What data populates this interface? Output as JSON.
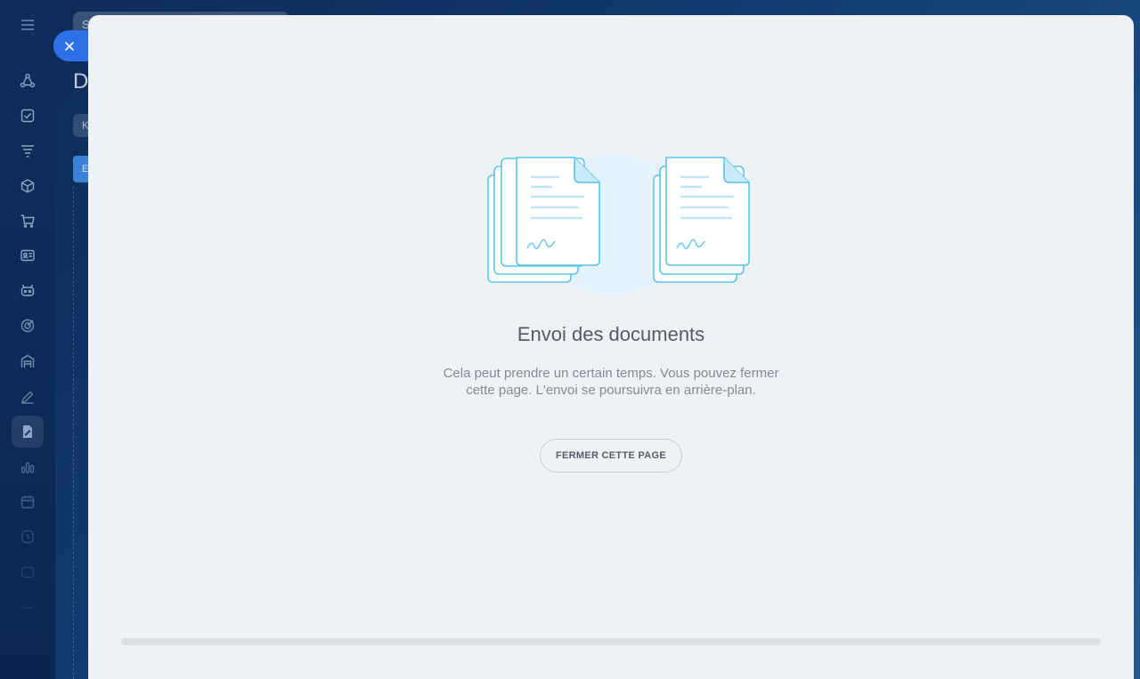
{
  "background": {
    "search_placeholder": "S",
    "page_title": "D",
    "chip_label": "K",
    "button_label": "E"
  },
  "slider": {
    "heading": "Envoi des documents",
    "description": "Cela peut prendre un certain temps. Vous pouvez fermer cette page. L'envoi se poursuivra en arrière-plan.",
    "close_page_label": "FERMER CETTE PAGE",
    "progress_fraction": 0
  },
  "sidebar": {
    "items": [
      {
        "icon": "menu-icon"
      },
      {
        "icon": "workflow-icon"
      },
      {
        "icon": "task-checkbox-icon"
      },
      {
        "icon": "funnel-icon"
      },
      {
        "icon": "box-icon"
      },
      {
        "icon": "cart-icon"
      },
      {
        "icon": "contact-card-icon"
      },
      {
        "icon": "robot-icon"
      },
      {
        "icon": "target-icon"
      },
      {
        "icon": "warehouse-icon"
      },
      {
        "icon": "pen-icon"
      },
      {
        "icon": "document-sign-icon"
      },
      {
        "icon": "analytics-icon"
      },
      {
        "icon": "calendar-icon"
      },
      {
        "icon": "clock-icon"
      },
      {
        "icon": "more-icon"
      }
    ]
  },
  "colors": {
    "accent": "#2f6fe8",
    "panel_bg": "#eef2f5",
    "illustration_stroke": "#5bc4ea"
  }
}
